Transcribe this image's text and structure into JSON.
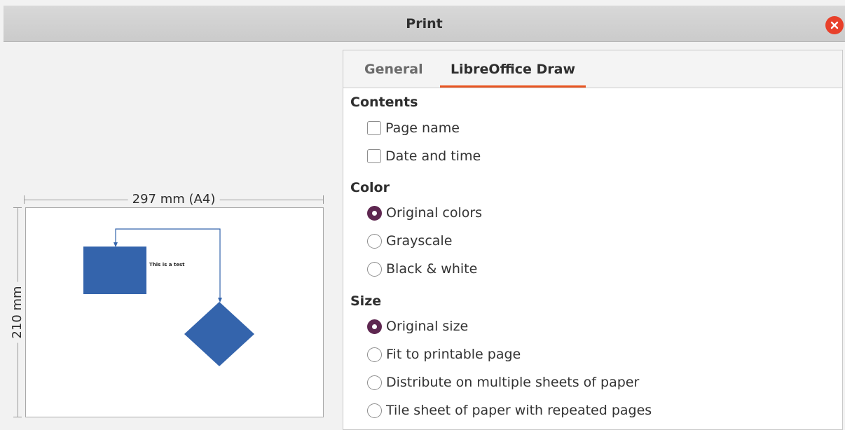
{
  "window": {
    "title": "Print"
  },
  "preview": {
    "width_label": "297 mm (A4)",
    "height_label": "210 mm",
    "drawing_text": "This is a test",
    "shape_color": "#3464ac"
  },
  "tabs": [
    {
      "label": "General",
      "active": false
    },
    {
      "label": "LibreOffice Draw",
      "active": true
    }
  ],
  "contents": {
    "title": "Contents",
    "options": [
      {
        "label": "Page name",
        "checked": false
      },
      {
        "label": "Date and time",
        "checked": false
      }
    ]
  },
  "color": {
    "title": "Color",
    "options": [
      {
        "label": "Original colors",
        "selected": true
      },
      {
        "label": "Grayscale",
        "selected": false
      },
      {
        "label": "Black & white",
        "selected": false
      }
    ]
  },
  "size": {
    "title": "Size",
    "options": [
      {
        "label": "Original size",
        "selected": true
      },
      {
        "label": "Fit to printable page",
        "selected": false
      },
      {
        "label": "Distribute on multiple sheets of paper",
        "selected": false
      },
      {
        "label": "Tile sheet of paper with repeated pages",
        "selected": false
      }
    ]
  },
  "colors": {
    "accent": "#e95420",
    "radio_selected": "#5e2750",
    "close": "#e8402a"
  }
}
